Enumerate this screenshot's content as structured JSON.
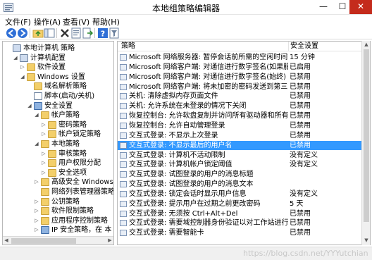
{
  "window": {
    "title": "本地组策略编辑器",
    "minimize_glyph": "—",
    "maximize_glyph": "☐",
    "close_glyph": "✕"
  },
  "menu": [
    "文件(F)",
    "操作(A)",
    "查看(V)",
    "帮助(H)"
  ],
  "toolbar": {
    "buttons": [
      "back-icon",
      "forward-icon",
      "up-folder-icon",
      "show-hide-tree-icon",
      "delete-icon",
      "properties-icon",
      "export-list-icon",
      "help-icon",
      "filter-icon"
    ]
  },
  "tree": [
    {
      "label": "本地计算机 策略",
      "icon": "computer-policy-icon",
      "expanded": null
    },
    {
      "label": "计算机配置",
      "icon": "computer-icon",
      "expanded": true
    },
    {
      "label": "软件设置",
      "icon": "folder-icon",
      "expanded": false
    },
    {
      "label": "Windows 设置",
      "icon": "folder-icon",
      "expanded": true
    },
    {
      "label": "域名解析策略",
      "icon": "folder-icon",
      "expanded": null
    },
    {
      "label": "脚本(启动/关机)",
      "icon": "script-icon",
      "expanded": null
    },
    {
      "label": "安全设置",
      "icon": "shield-icon",
      "expanded": true
    },
    {
      "label": "帐户策略",
      "icon": "folder-icon",
      "expanded": true
    },
    {
      "label": "密码策略",
      "icon": "folder-icon",
      "expanded": false
    },
    {
      "label": "帐户锁定策略",
      "icon": "folder-icon",
      "expanded": false
    },
    {
      "label": "本地策略",
      "icon": "folder-icon",
      "expanded": true
    },
    {
      "label": "审核策略",
      "icon": "folder-icon",
      "expanded": false
    },
    {
      "label": "用户权限分配",
      "icon": "folder-icon",
      "expanded": false
    },
    {
      "label": "安全选项",
      "icon": "folder-icon",
      "expanded": false
    },
    {
      "label": "高级安全 Windows",
      "icon": "folder-icon",
      "expanded": false
    },
    {
      "label": "网络列表管理器策略",
      "icon": "folder-icon",
      "expanded": null
    },
    {
      "label": "公钥策略",
      "icon": "folder-icon",
      "expanded": false
    },
    {
      "label": "软件限制策略",
      "icon": "folder-icon",
      "expanded": false
    },
    {
      "label": "应用程序控制策略",
      "icon": "folder-icon",
      "expanded": false
    },
    {
      "label": "IP 安全策略，在 本",
      "icon": "ip-security-icon",
      "expanded": false
    }
  ],
  "list": {
    "columns": [
      "策略",
      "安全设置"
    ],
    "selected_index": 9,
    "rows": [
      {
        "policy": "Microsoft 网络服务器: 暂停会话前所需的空闲时间数量",
        "setting": "15 分钟"
      },
      {
        "policy": "Microsoft 网络客户端: 对通信进行数字签名(如果服务器允...",
        "setting": "已启用"
      },
      {
        "policy": "Microsoft 网络客户端: 对通信进行数字签名(始终)",
        "setting": "已禁用"
      },
      {
        "policy": "Microsoft 网络客户端: 将未加密的密码发送到第三方 SMB...",
        "setting": "已禁用"
      },
      {
        "policy": "关机: 清除虚拟内存页面文件",
        "setting": "已禁用"
      },
      {
        "policy": "关机: 允许系统在未登录的情况下关闭",
        "setting": "已禁用"
      },
      {
        "policy": "恢复控制台: 允许软盘复制并访问所有驱动器和所有文件夹",
        "setting": "已禁用"
      },
      {
        "policy": "恢复控制台: 允许自动管理登录",
        "setting": "已禁用"
      },
      {
        "policy": "交互式登录: 不显示上次登录",
        "setting": "已禁用"
      },
      {
        "policy": "交互式登录: 不显示最后的用户名",
        "setting": "已禁用"
      },
      {
        "policy": "交互式登录: 计算机不活动限制",
        "setting": "没有定义"
      },
      {
        "policy": "交互式登录: 计算机帐户锁定阈值",
        "setting": "没有定义"
      },
      {
        "policy": "交互式登录: 试图登录的用户的消息标题",
        "setting": ""
      },
      {
        "policy": "交互式登录: 试图登录的用户的消息文本",
        "setting": ""
      },
      {
        "policy": "交互式登录: 锁定会话时显示用户信息",
        "setting": "没有定义"
      },
      {
        "policy": "交互式登录: 提示用户在过期之前更改密码",
        "setting": "5 天"
      },
      {
        "policy": "交互式登录: 无须按 Ctrl+Alt+Del",
        "setting": "已禁用"
      },
      {
        "policy": "交互式登录: 需要域控制器身份验证以对工作站进行解锁",
        "setting": "已禁用"
      },
      {
        "policy": "交互式登录: 需要智能卡",
        "setting": "已禁用"
      }
    ]
  },
  "watermark": "https://blog.csdn.net/YYYutchian",
  "colors": {
    "selection": "#3399ff",
    "close_button": "#c42b1c",
    "folder": "#f3cf6a"
  }
}
